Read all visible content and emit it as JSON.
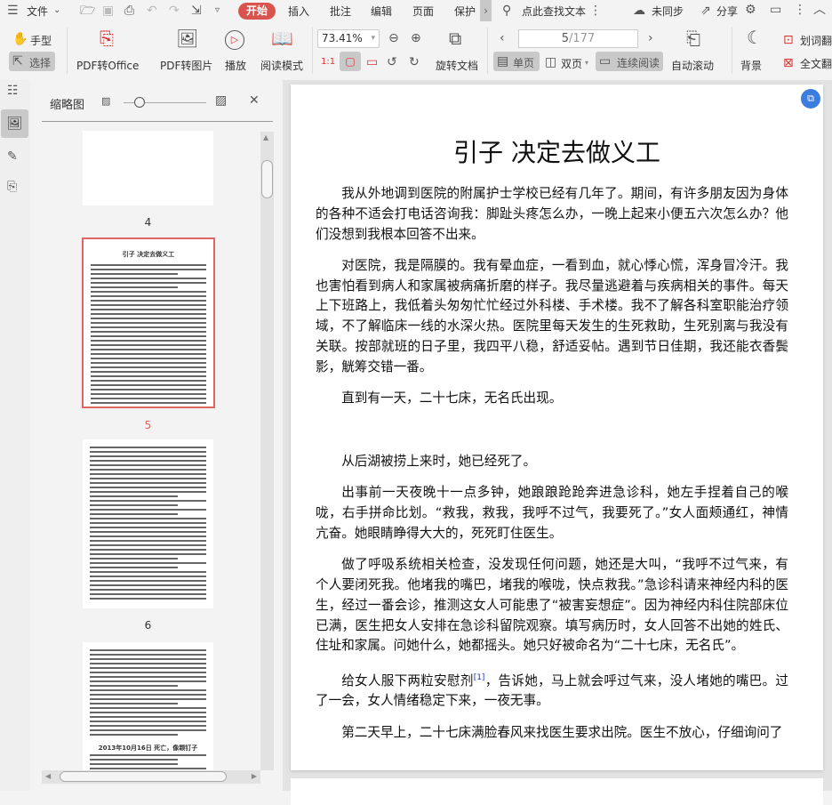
{
  "menu": {
    "file": "文件",
    "start": "开始",
    "tabs": [
      "插入",
      "批注",
      "编辑",
      "页面",
      "保护"
    ],
    "search": "点此查找文本",
    "sync": "未同步",
    "share": "分享"
  },
  "toolbar": {
    "hand": "手型",
    "select": "选择",
    "pdf_to_office": "PDF转Office",
    "pdf_to_image": "PDF转图片",
    "play": "播放",
    "read_mode": "阅读模式",
    "zoom": "73.41%",
    "rotate": "旋转文档",
    "page_current": "5",
    "page_total": "/177",
    "single": "单页",
    "double": "双页",
    "continuous": "连续阅读",
    "autoscroll": "自动滚动",
    "background": "背景",
    "word_pick": "划词翻",
    "full_translate": "全文翻"
  },
  "panel": {
    "title": "缩略图",
    "thumb_labels": [
      "4",
      "5",
      "6"
    ],
    "thumb5_title": "引子 决定去做义工",
    "thumb7_title": "2013年10月16日 死亡，像颗钉子"
  },
  "doc": {
    "title": "引子  决定去做义工",
    "paragraphs": [
      "我从外地调到医院的附属护士学校已经有几年了。期间，有许多朋友因为身体的各种不适会打电话咨询我：脚趾头疼怎么办，一晚上起来小便五六次怎么办？他们没想到我根本回答不出来。",
      "对医院，我是隔膜的。我有晕血症，一看到血，就心悸心慌，浑身冒冷汗。我也害怕看到病人和家属被病痛折磨的样子。我尽量逃避着与疾病相关的事件。每天上下班路上，我低着头匆匆忙忙经过外科楼、手术楼。我不了解各科室职能治疗领域，不了解临床一线的水深火热。医院里每天发生的生死救助，生死别离与我没有关联。按部就班的日子里，我四平八稳，舒适妥帖。遇到节日佳期，我还能衣香鬓影，觥筹交错一番。",
      "直到有一天，二十七床，无名氏出现。",
      "从后湖被捞上来时，她已经死了。",
      "出事前一天夜晚十一点多钟，她踉踉跄跄奔进急诊科，她左手捏着自己的喉咙，右手拼命比划。“救我，救我，我呼不过气，我要死了。”女人面颊通红，神情亢奋。她眼睛睁得大大的，死死盯住医生。",
      "做了呼吸系统相关检查，没发现任何问题，她还是大叫，“我呼不过气来，有个人要闭死我。他堵我的嘴巴，堵我的喉咙，快点救我。”急诊科请来神经内科的医生，经过一番会诊，推测这女人可能患了“被害妄想症”。因为神经内科住院部床位已满，医生把女人安排在急诊科留院观察。填写病历时，女人回答不出她的姓氏、住址和家属。问她什么，她都摇头。她只好被命名为“二十七床，无名氏”。"
    ],
    "p7_before": "给女人服下两粒安慰剂",
    "footnote": "[1]",
    "p7_after": "，告诉她，马上就会呼过气来，没人堵她的嘴巴。过了一会，女人情绪稳定下来，一夜无事。",
    "p8": "第二天早上，二十七床满脸春风来找医生要求出院。医生不放心，仔细询问了"
  }
}
